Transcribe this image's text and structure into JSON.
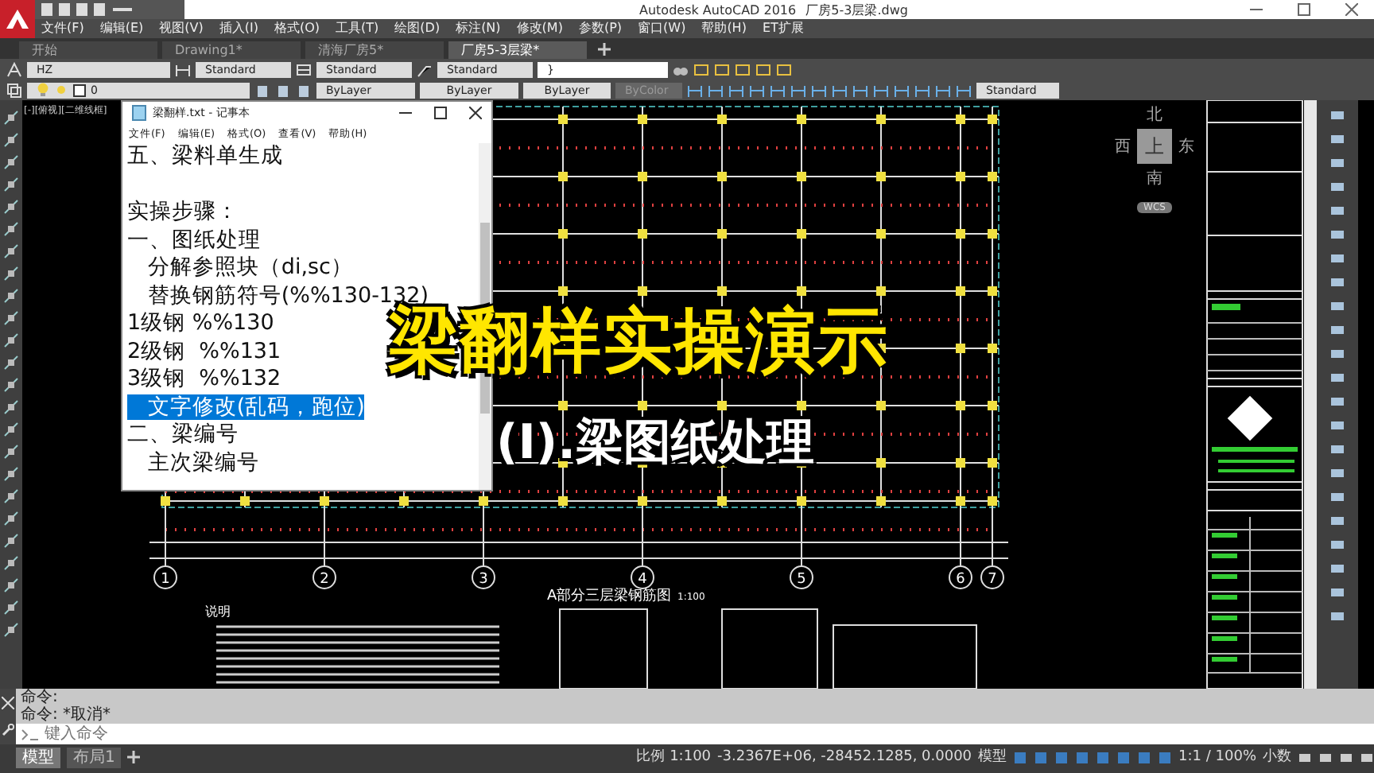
{
  "app": {
    "title": "Autodesk AutoCAD 2016",
    "file": "厂房5-3层梁.dwg"
  },
  "menu": [
    "文件(F)",
    "编辑(E)",
    "视图(V)",
    "插入(I)",
    "格式(O)",
    "工具(T)",
    "绘图(D)",
    "标注(N)",
    "修改(M)",
    "参数(P)",
    "窗口(W)",
    "帮助(H)",
    "ET扩展"
  ],
  "tabs": [
    {
      "label": "开始",
      "selected": false
    },
    {
      "label": "Drawing1*",
      "selected": false
    },
    {
      "label": "清海厂房5*",
      "selected": false
    },
    {
      "label": "厂房5-3层梁*",
      "selected": true
    }
  ],
  "toolbar": {
    "text_style": "HZ",
    "dim_style": "Standard",
    "table_style": "Standard",
    "mleader_style": "Standard",
    "search": "}",
    "layer": "0",
    "color_control": "ByLayer",
    "linetype": "ByLayer",
    "lineweight": "ByLayer",
    "plot_style": "ByColor",
    "visual_style": "Standard"
  },
  "viewport_label": "[-][俯视][二维线框]",
  "notepad": {
    "title": "梁翻样.txt - 记事本",
    "menu": [
      "文件(F)",
      "编辑(E)",
      "格式(O)",
      "查看(V)",
      "帮助(H)"
    ],
    "lines": [
      {
        "kind": "text",
        "text": "五、梁料单生成",
        "selected": false
      },
      {
        "kind": "blank"
      },
      {
        "kind": "text",
        "text": "实操步骤：",
        "selected": false
      },
      {
        "kind": "text",
        "text": "一、图纸处理",
        "selected": false
      },
      {
        "kind": "text",
        "text": "   分解参照块（di,sc）",
        "selected": false
      },
      {
        "kind": "text",
        "text": "   替换钢筋符号(%%130-132)",
        "selected": false
      },
      {
        "kind": "text",
        "text": "1级钢 %%130",
        "selected": false
      },
      {
        "kind": "text",
        "text": "2级钢  %%131",
        "selected": false
      },
      {
        "kind": "text",
        "text": "3级钢  %%132",
        "selected": false
      },
      {
        "kind": "text",
        "text": "   文字修改(乱码，跑位)",
        "selected": true
      },
      {
        "kind": "text",
        "text": "二、梁编号",
        "selected": false
      },
      {
        "kind": "text",
        "text": "   主次梁编号",
        "selected": false
      }
    ]
  },
  "captions": [
    {
      "text": "梁翻样实操演示",
      "kind": "title"
    },
    {
      "text": "(I).梁图纸处理",
      "kind": "subtitle"
    }
  ],
  "viewcube": {
    "north": "北",
    "south": "南",
    "east": "东",
    "west": "西",
    "top": "上",
    "wcs": "WCS"
  },
  "drawing": {
    "axes": [
      "1",
      "2",
      "3",
      "4",
      "5",
      "6",
      "7"
    ],
    "title": "A部分三层梁钢筋图",
    "scale": "1:100",
    "notes_heading": "说明"
  },
  "command": {
    "history": [
      "命令:",
      "命令: *取消*"
    ],
    "placeholder": "键入命令"
  },
  "layout_tabs": [
    {
      "label": "模型",
      "selected": true
    },
    {
      "label": "布局1",
      "selected": false
    }
  ],
  "status": {
    "scale": "比例 1:100",
    "coords": "-3.2367E+06, -28452.1285, 0.0000",
    "space": "模型",
    "annotation_scale": "1:1 / 100%",
    "units": "小数"
  }
}
